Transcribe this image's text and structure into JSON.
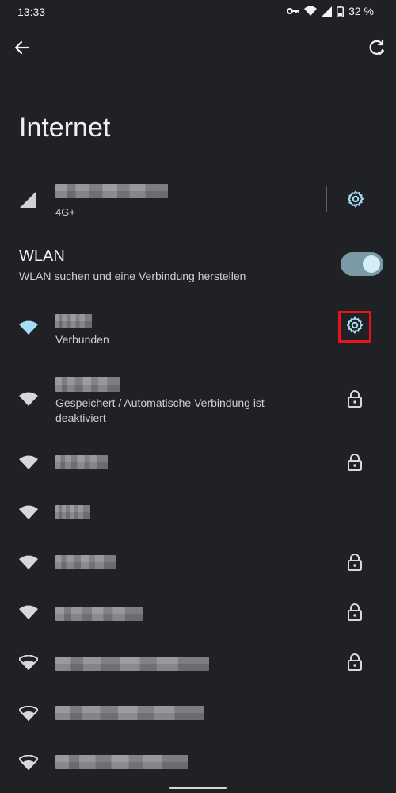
{
  "status_bar": {
    "time": "13:33",
    "battery_percent": "32 %",
    "icons": [
      "vpn-key-icon",
      "wifi-icon",
      "signal-icon",
      "battery-icon"
    ]
  },
  "header": {
    "back_icon": "arrow-back-icon",
    "sync_icon": "network-reset-icon",
    "title": "Internet"
  },
  "mobile": {
    "network_type": "4G+",
    "signal_icon": "cell-signal-icon",
    "settings_icon": "gear-icon"
  },
  "wlan": {
    "title": "WLAN",
    "subtitle": "WLAN suchen und eine Verbindung herstellen",
    "enabled": true
  },
  "networks": [
    {
      "status": "Verbunden",
      "connected": true,
      "action": "gear-icon"
    },
    {
      "status": "Gespeichert / Automatische Verbindung ist deaktiviert",
      "connected": false,
      "action": "lock-icon"
    },
    {
      "status": "",
      "connected": false,
      "action": "lock-icon"
    },
    {
      "status": "",
      "connected": false,
      "action": ""
    },
    {
      "status": "",
      "connected": false,
      "action": "lock-icon"
    },
    {
      "status": "",
      "connected": false,
      "action": "lock-icon"
    },
    {
      "status": "",
      "connected": false,
      "action": "lock-icon"
    },
    {
      "status": "",
      "connected": false,
      "action": ""
    },
    {
      "status": "",
      "connected": false,
      "action": ""
    }
  ],
  "colors": {
    "background": "#1f2124",
    "accent": "#a8dcf5",
    "highlight_box": "#e8141c"
  }
}
